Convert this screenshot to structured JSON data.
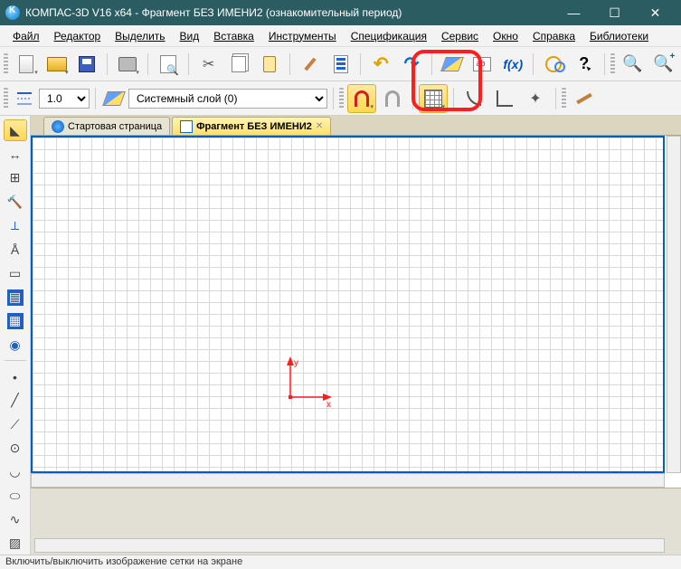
{
  "titlebar": {
    "text": "КОМПАС-3D V16  x64 - Фрагмент БЕЗ ИМЕНИ2 (ознакомительный период)"
  },
  "menus": {
    "file": "Файл",
    "editor": "Редактор",
    "select": "Выделить",
    "view": "Вид",
    "insert": "Вставка",
    "tools": "Инструменты",
    "spec": "Спецификация",
    "service": "Сервис",
    "window": "Окно",
    "help": "Справка",
    "library": "Библиотеки"
  },
  "toolbar2": {
    "scale_value": "1.0",
    "layer_label": "Системный слой (0)"
  },
  "tabs": {
    "start": "Стартовая страница",
    "active": "Фрагмент БЕЗ ИМЕНИ2"
  },
  "axes": {
    "x": "x",
    "y": "y"
  },
  "status": {
    "text": "Включить/выключить изображение сетки на экране"
  }
}
